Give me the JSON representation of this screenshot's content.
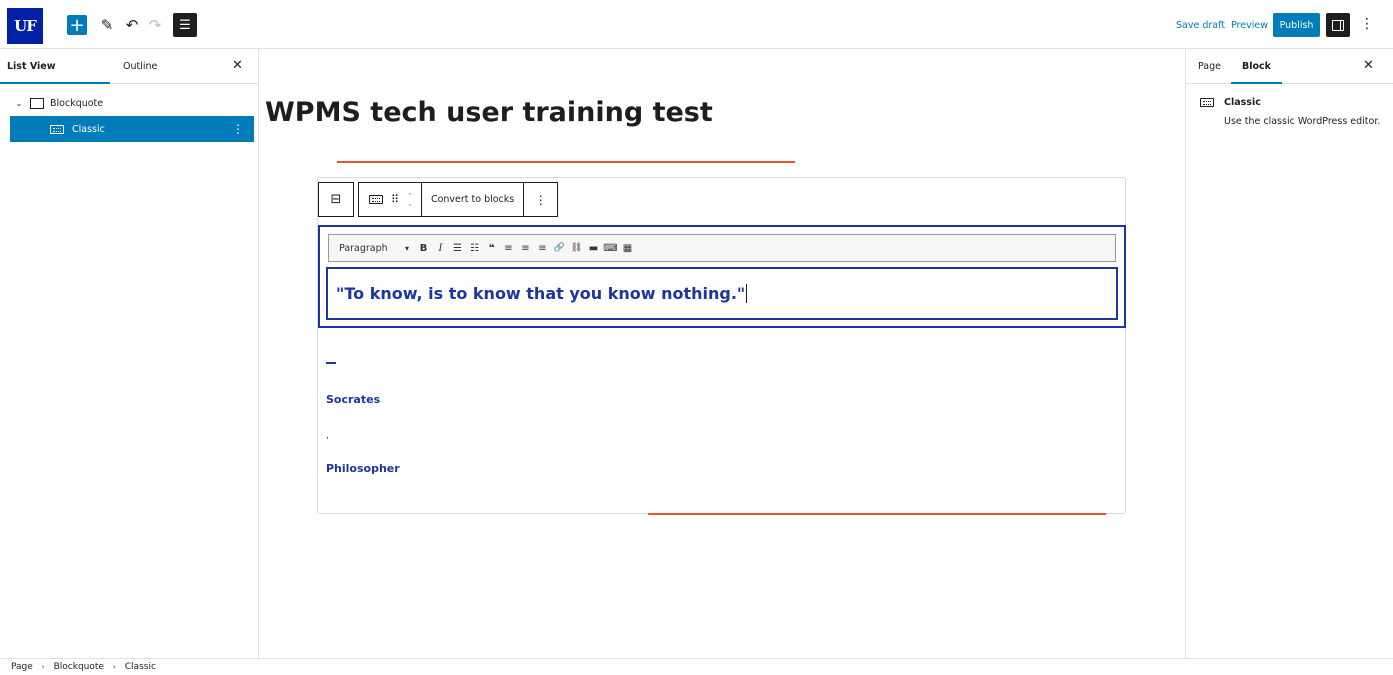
{
  "topbar": {
    "logo": "UF",
    "add_icon": "+",
    "pen_icon": "✎",
    "undo_icon": "↶",
    "redo_icon": "↷",
    "listview_icon": "☰",
    "save_draft": "Save draft",
    "preview": "Preview",
    "publish": "Publish",
    "more_icon": "⋮"
  },
  "left_panel": {
    "tabs": [
      "List View",
      "Outline"
    ],
    "close_icon": "✕",
    "tree": [
      {
        "label": "Blockquote"
      },
      {
        "label": "Classic"
      }
    ],
    "chevron_icon": "⌄",
    "row_more_icon": "⋮"
  },
  "editor": {
    "page_title": "WPMS tech user training test",
    "block_toolbar": {
      "convert_label": "Convert to blocks",
      "drag_icon": "⠿",
      "arrow_up": "⌃",
      "arrow_down": "⌄",
      "more_icon": "⋮",
      "parent_icon": "⊟"
    },
    "classic": {
      "format_select": "Paragraph",
      "select_caret": "▾",
      "buttons": [
        "B",
        "I",
        "☰",
        "☷",
        "❝",
        "≡",
        "≡",
        "≡",
        "🔗",
        "⛓",
        "▬",
        "⌨",
        "▦"
      ],
      "content": "\"To know, is to know that you know nothing.\""
    },
    "citation": {
      "name": "Socrates",
      "comma": ",",
      "role": "Philosopher"
    }
  },
  "right_panel": {
    "tabs": [
      "Page",
      "Block"
    ],
    "close_icon": "✕",
    "block_title": "Classic",
    "block_desc": "Use the classic WordPress editor."
  },
  "footer": {
    "breadcrumb": [
      "Page",
      "Blockquote",
      "Classic"
    ],
    "sep": "›"
  },
  "colors": {
    "accent": "#007cba",
    "uf_blue": "#0021a5",
    "quote_blue": "#1d35a0",
    "orange": "#e8562a"
  }
}
